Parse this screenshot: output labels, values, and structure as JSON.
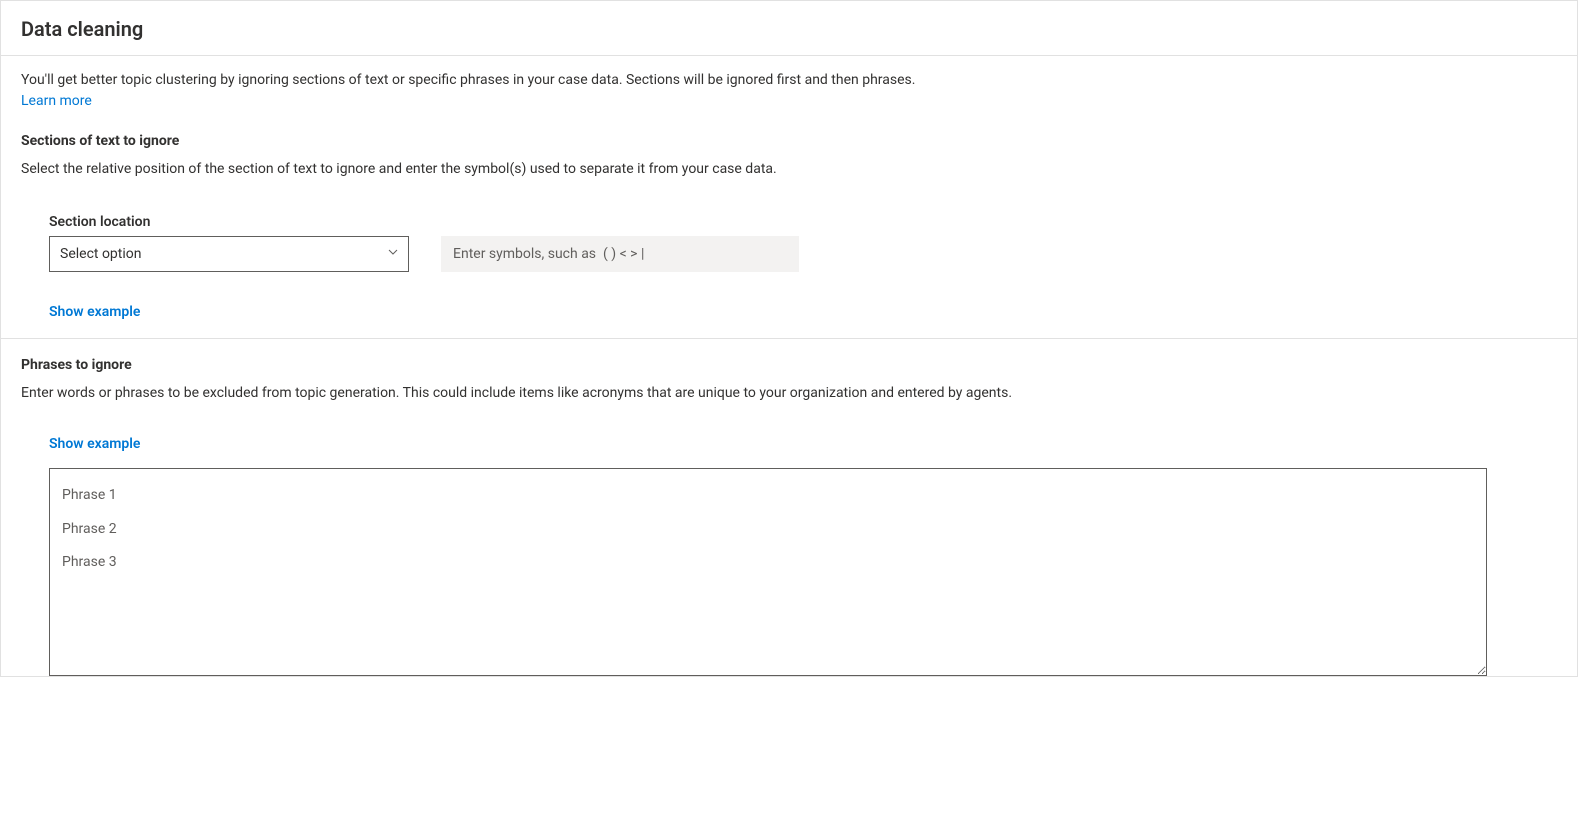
{
  "header": {
    "title": "Data cleaning"
  },
  "intro": {
    "description": "You'll get better topic clustering by ignoring sections of text or specific phrases in your case data. Sections will be ignored first and then phrases.",
    "learn_more": "Learn more"
  },
  "sections": {
    "heading": "Sections of text to ignore",
    "subtext": "Select the relative position of the section of text to ignore and enter the symbol(s) used to separate it from your case data.",
    "field_label": "Section location",
    "select_value": "Select option",
    "symbols_placeholder": "Enter symbols, such as  ( ) < > |",
    "show_example": "Show example"
  },
  "phrases": {
    "heading": "Phrases to ignore",
    "subtext": "Enter words or phrases to be excluded from topic generation. This could include items like acronyms that are unique to your organization and entered by agents.",
    "show_example": "Show example",
    "textarea_placeholder": "Phrase 1\nPhrase 2\nPhrase 3"
  }
}
